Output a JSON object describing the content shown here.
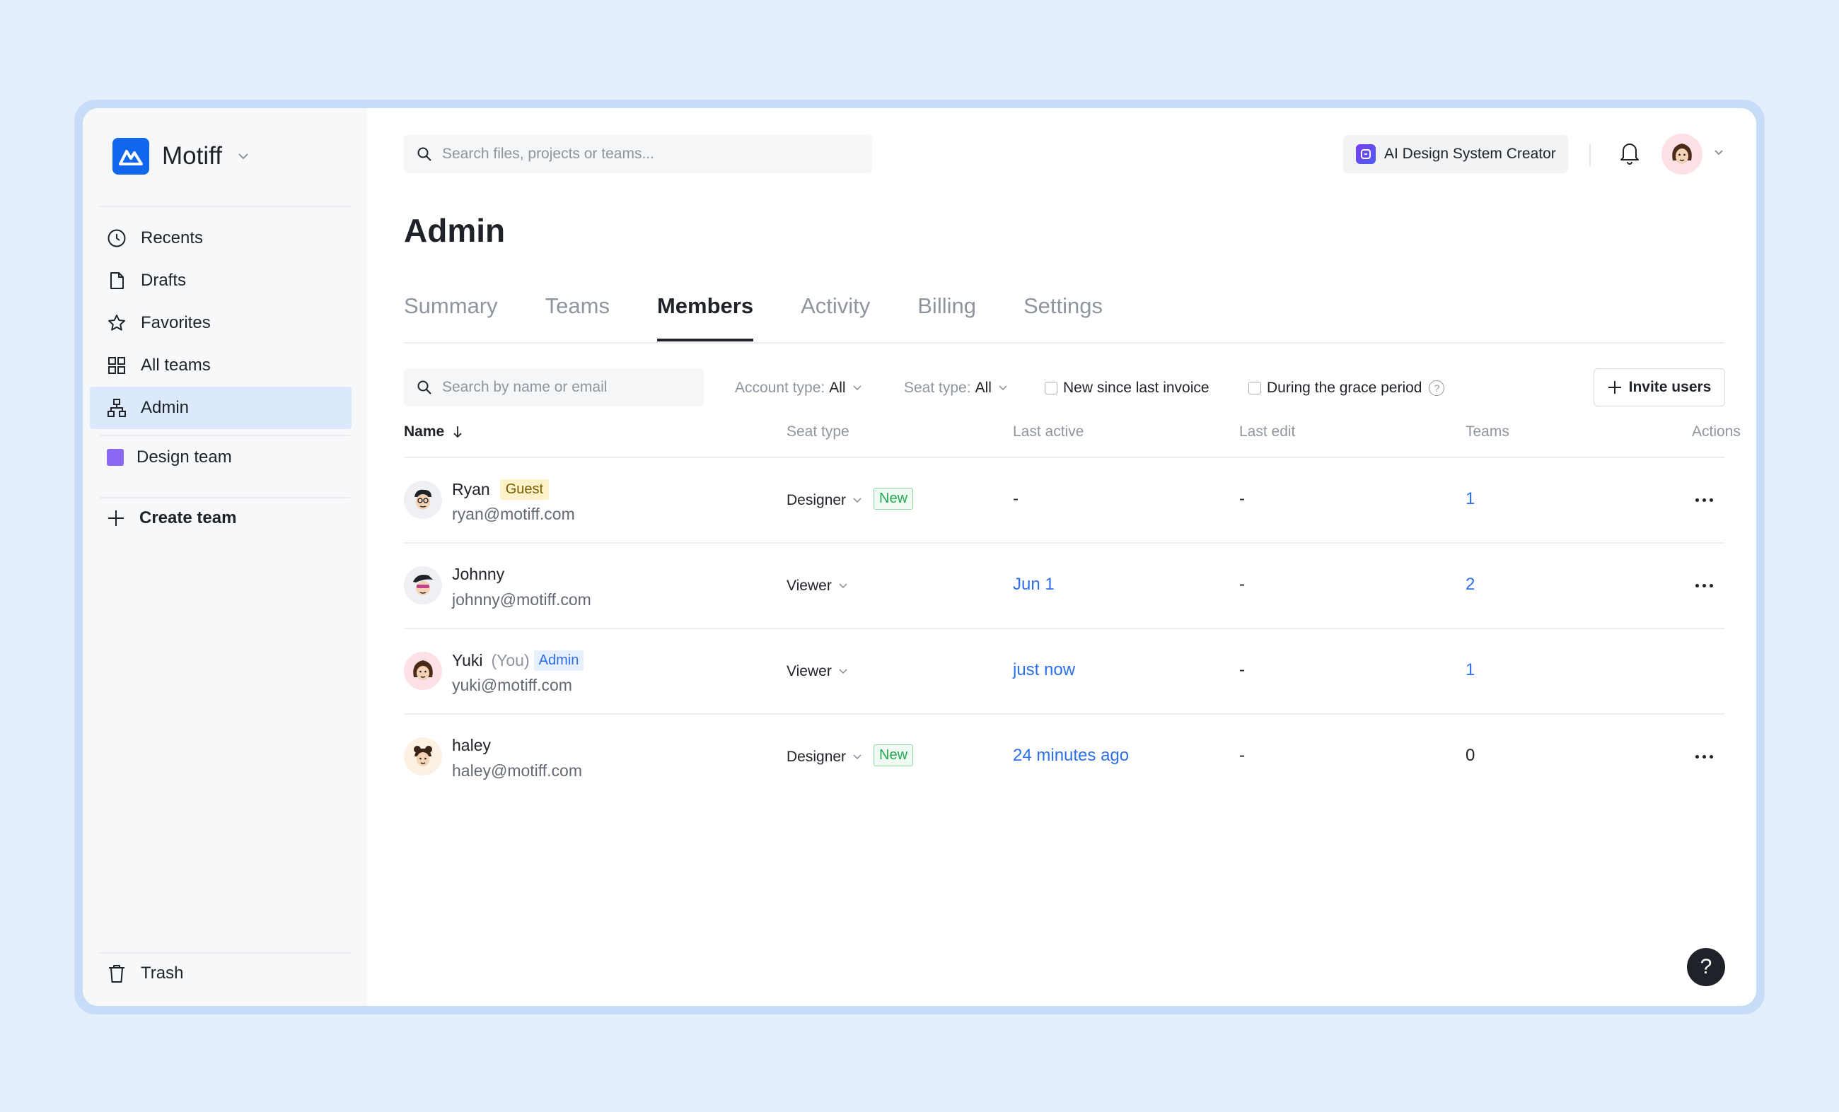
{
  "brand": {
    "name": "Motiff"
  },
  "sidebar": {
    "items": [
      {
        "label": "Recents",
        "icon": "clock-icon"
      },
      {
        "label": "Drafts",
        "icon": "file-icon"
      },
      {
        "label": "Favorites",
        "icon": "star-icon"
      },
      {
        "label": "All teams",
        "icon": "grid-icon"
      },
      {
        "label": "Admin",
        "icon": "org-icon",
        "active": true
      }
    ],
    "team": "Design team",
    "create_team": "Create team",
    "trash": "Trash"
  },
  "header": {
    "search_placeholder": "Search files, projects or teams...",
    "ai_button": "AI Design System Creator"
  },
  "page": {
    "title": "Admin"
  },
  "tabs": [
    {
      "label": "Summary"
    },
    {
      "label": "Teams"
    },
    {
      "label": "Members",
      "active": true
    },
    {
      "label": "Activity"
    },
    {
      "label": "Billing"
    },
    {
      "label": "Settings"
    }
  ],
  "toolbar": {
    "member_search_placeholder": "Search by name or email",
    "account_type_label": "Account type:",
    "account_type_value": "All",
    "seat_type_label": "Seat type:",
    "seat_type_value": "All",
    "new_since_label": "New since last invoice",
    "grace_period_label": "During the grace period",
    "help_glyph": "?",
    "invite_label": "Invite users"
  },
  "table": {
    "headers": {
      "name": "Name",
      "seat_type": "Seat type",
      "last_active": "Last active",
      "last_edit": "Last edit",
      "teams": "Teams",
      "actions": "Actions"
    },
    "rows": [
      {
        "name": "Ryan",
        "email": "ryan@motiff.com",
        "badge": "Guest",
        "you": "",
        "admin": "",
        "seat": "Designer",
        "seat_new": "New",
        "last_active": "-",
        "last_edit": "-",
        "teams": "1",
        "actions": true
      },
      {
        "name": "Johnny",
        "email": "johnny@motiff.com",
        "badge": "",
        "you": "",
        "admin": "",
        "seat": "Viewer",
        "seat_new": "",
        "last_active": "Jun 1",
        "last_edit": "-",
        "teams": "2",
        "actions": true
      },
      {
        "name": "Yuki",
        "email": "yuki@motiff.com",
        "badge": "",
        "you": "(You)",
        "admin": "Admin",
        "seat": "Viewer",
        "seat_new": "",
        "last_active": "just now",
        "last_edit": "-",
        "teams": "1",
        "actions": false
      },
      {
        "name": "haley",
        "email": "haley@motiff.com",
        "badge": "",
        "you": "",
        "admin": "",
        "seat": "Designer",
        "seat_new": "New",
        "last_active": "24 minutes ago",
        "last_edit": "-",
        "teams": "0",
        "actions": true
      }
    ]
  },
  "help_fab": "?",
  "colors": {
    "accent": "#2c6fe8",
    "brand": "#1166ee",
    "active_nav": "#dce9fc",
    "new_badge": "#22a852",
    "guest_badge": "#fdf2c8",
    "team_swatch": "#8b67f5"
  }
}
